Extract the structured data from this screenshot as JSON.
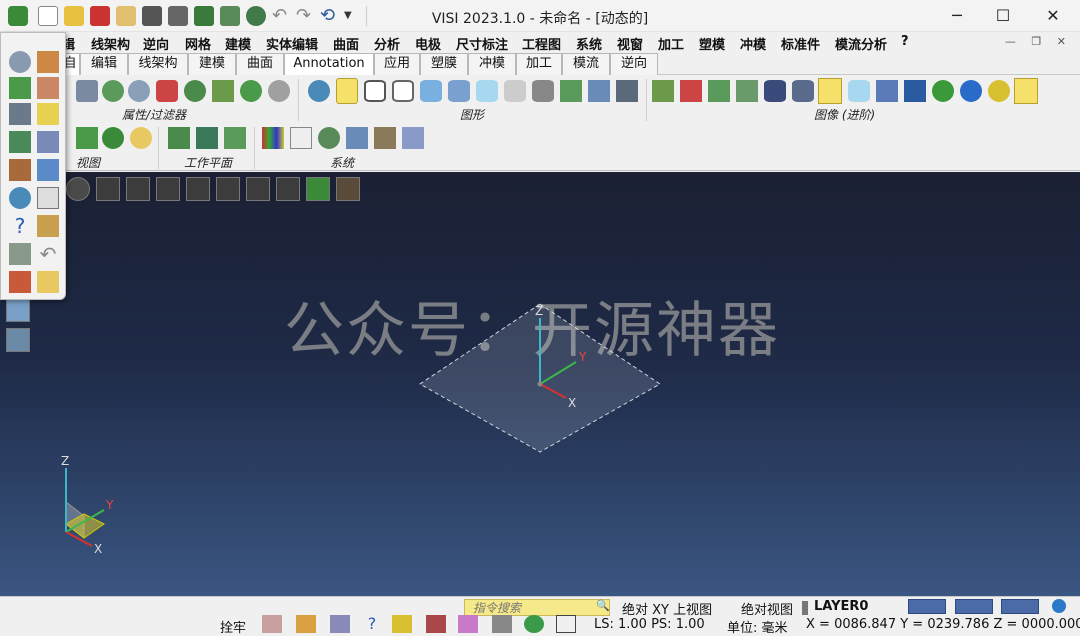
{
  "window": {
    "title": "VISI 2023.1.0 - 未命名 - [动态的]"
  },
  "menu": [
    "编辑",
    "线架构",
    "逆向",
    "网格",
    "建模",
    "实体编辑",
    "曲面",
    "分析",
    "电极",
    "尺寸标注",
    "工程图",
    "系统",
    "视窗",
    "加工",
    "塑模",
    "冲模",
    "标准件",
    "模流分析",
    "?"
  ],
  "menu_first": "辑",
  "tabs": [
    "编辑",
    "线架构",
    "建模",
    "曲面",
    "Annotation",
    "应用",
    "塑膜",
    "冲模",
    "加工",
    "模流",
    "逆向"
  ],
  "tab_first": "自",
  "ribbon_groups": {
    "attr": "属性/过滤器",
    "shape": "图形",
    "image": "图像 (进阶)",
    "view": "视图",
    "workplane": "工作平面",
    "system": "系统"
  },
  "watermark": "公众号：开源神器",
  "axes": {
    "z": "Z",
    "y": "Y",
    "x": "X"
  },
  "status": {
    "search_placeholder": "指令搜索",
    "view_mode": "绝对 XY 上视图",
    "abs_view": "绝对视图",
    "layer": "LAYER0",
    "snap": "拴牢",
    "ls_ps": "LS: 1.00 PS: 1.00",
    "unit": "单位: 毫米",
    "coords": "X = 0086.847 Y = 0239.786 Z = 0000.000"
  },
  "colors": {
    "accent": "#4a6aa8",
    "search_bg": "#f5e98a",
    "viewport_top": "#1b2033",
    "viewport_bottom": "#3a5682"
  }
}
